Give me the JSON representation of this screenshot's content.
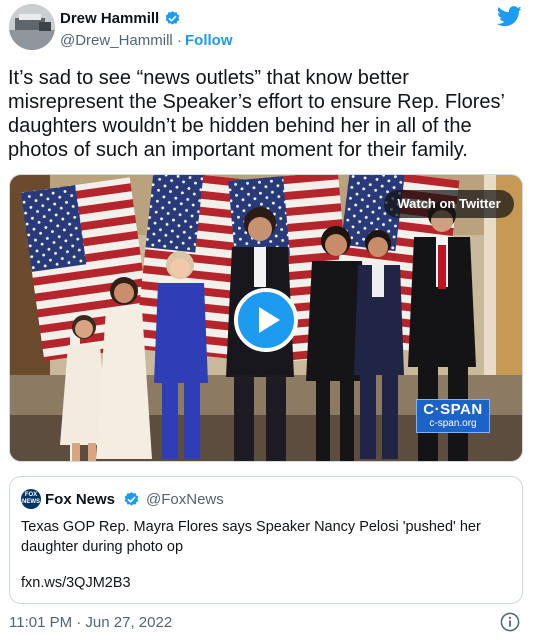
{
  "author": {
    "name": "Drew Hammill",
    "handle": "@Drew_Hammill",
    "separator": "·",
    "follow_label": "Follow"
  },
  "tweet": {
    "lines": [
      "It’s sad to see “news outlets” that know better",
      "misrepresent the Speaker’s effort to ensure Rep. Flores’",
      "daughters wouldn’t be hidden behind her in all of the",
      "photos of such an important moment for their family."
    ]
  },
  "media": {
    "watch_label": "Watch on Twitter",
    "watermark_title": "C·SPAN",
    "watermark_url": "c-span.org"
  },
  "quote": {
    "avatar_text": "FOX NEWS",
    "name": "Fox News",
    "handle": "@FoxNews",
    "lines": [
      "Texas GOP Rep. Mayra Flores says Speaker Nancy Pelosi 'pushed' her",
      "daughter during photo op"
    ],
    "link": "fxn.ws/3QJM2B3"
  },
  "footer": {
    "timestamp": "11:01 PM · Jun 27, 2022"
  },
  "colors": {
    "accent": "#1d9bf0",
    "text": "#0f1419",
    "secondary_text": "#536471",
    "border": "#cfd9de",
    "cspan_blue": "#1b63c6"
  },
  "icons": {
    "verified": "verified-badge-icon",
    "brand": "twitter-bird-icon",
    "play": "play-icon",
    "info": "info-icon"
  }
}
